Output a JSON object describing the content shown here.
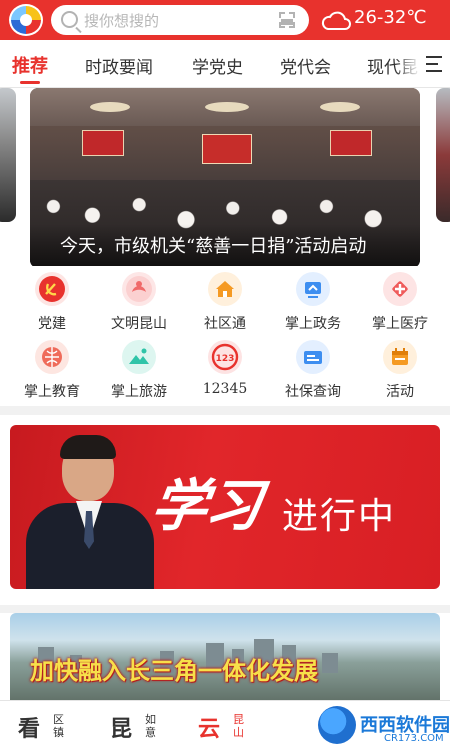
{
  "header": {
    "search_placeholder": "搜你想搜的",
    "weather_temp": "26-32℃"
  },
  "tabs": [
    {
      "label": "推荐",
      "active": true
    },
    {
      "label": "时政要闻",
      "active": false
    },
    {
      "label": "学党史",
      "active": false
    },
    {
      "label": "党代会",
      "active": false
    },
    {
      "label": "现代昆",
      "active": false
    }
  ],
  "carousel": {
    "caption": "今天，市级机关“慈善一日捐”活动启动"
  },
  "services": [
    {
      "label": "党建",
      "icon": "party-emblem-icon",
      "color": "#e8322d"
    },
    {
      "label": "文明昆山",
      "icon": "civilization-icon",
      "color": "#f06a6a"
    },
    {
      "label": "社区通",
      "icon": "home-icon",
      "color": "#f59a23"
    },
    {
      "label": "掌上政务",
      "icon": "government-icon",
      "color": "#3d8ef0"
    },
    {
      "label": "掌上医疗",
      "icon": "medical-icon",
      "color": "#ef5a5a"
    },
    {
      "label": "掌上教育",
      "icon": "education-icon",
      "color": "#ef6b5a"
    },
    {
      "label": "掌上旅游",
      "icon": "travel-icon",
      "color": "#2fc4a8"
    },
    {
      "label": "12345",
      "icon": "hotline-icon",
      "color": "#e8322d"
    },
    {
      "label": "社保查询",
      "icon": "social-security-icon",
      "color": "#3d8ef0"
    },
    {
      "label": "活动",
      "icon": "calendar-icon",
      "color": "#f59a23"
    }
  ],
  "banners": {
    "study_calligraphy": "学习",
    "study_text": "进行中",
    "delta_title": "加快融入长三角一体化发展"
  },
  "bottom_nav": [
    {
      "big": "看",
      "small": "区镇",
      "active": false
    },
    {
      "big": "昆",
      "small": "如意",
      "active": false
    },
    {
      "big": "云",
      "small": "昆山",
      "active": true
    }
  ],
  "watermark": {
    "name": "西西软件园",
    "url": "CR173.COM"
  }
}
